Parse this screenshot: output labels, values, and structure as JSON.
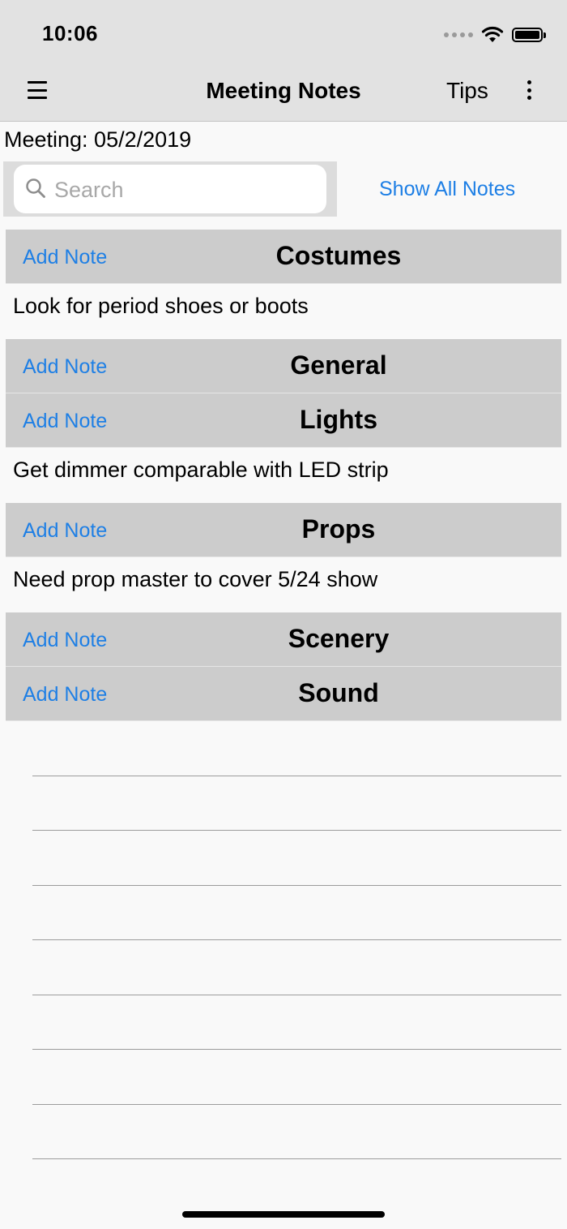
{
  "status_bar": {
    "time": "10:06",
    "icons": [
      "signal-icon",
      "wifi-icon",
      "battery-icon"
    ]
  },
  "nav": {
    "menu_icon": "hamburger-icon",
    "title": "Meeting Notes",
    "tips_label": "Tips",
    "more_icon": "kebab-icon"
  },
  "meeting": {
    "label": "Meeting: 05/2/2019"
  },
  "search": {
    "placeholder": "Search",
    "value": ""
  },
  "show_all_label": "Show All Notes",
  "sections": [
    {
      "title": "Costumes",
      "add_label": "Add Note",
      "notes": [
        "Look for period shoes or boots"
      ]
    },
    {
      "title": "General",
      "add_label": "Add Note",
      "notes": []
    },
    {
      "title": "Lights",
      "add_label": "Add Note",
      "notes": [
        "Get dimmer comparable with LED strip"
      ]
    },
    {
      "title": "Props",
      "add_label": "Add Note",
      "notes": [
        "Need prop master to cover 5/24 show"
      ]
    },
    {
      "title": "Scenery",
      "add_label": "Add Note",
      "notes": []
    },
    {
      "title": "Sound",
      "add_label": "Add Note",
      "notes": []
    }
  ],
  "colors": {
    "accent": "#1e7fe5",
    "header_bg": "#e2e2e2",
    "section_bg": "#cccccc",
    "background": "#f9f9f9"
  }
}
